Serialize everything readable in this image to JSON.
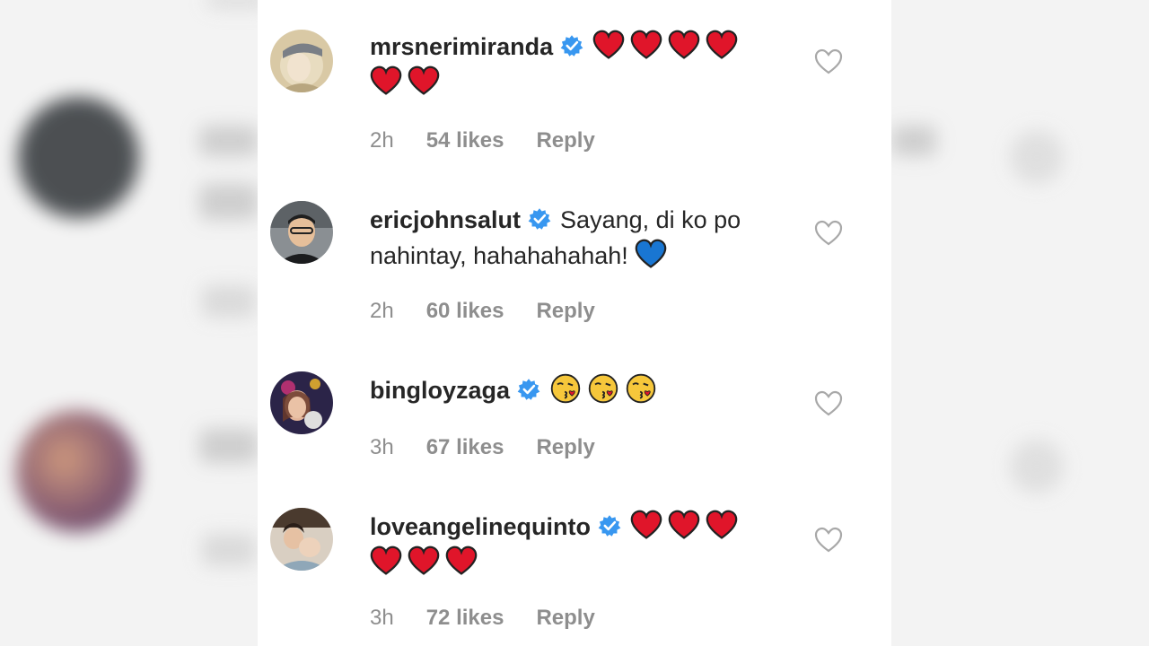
{
  "comments": [
    {
      "username": "mrsnerimiranda",
      "text": "",
      "emojis": [
        "red-heart",
        "red-heart",
        "red-heart",
        "red-heart",
        "red-heart",
        "red-heart"
      ],
      "time": "2h",
      "likes": "54 likes",
      "reply": "Reply"
    },
    {
      "username": "ericjohnsalut",
      "text": "Sayang, di ko po nahintay, hahahahahah!",
      "emojis": [
        "blue-heart"
      ],
      "time": "2h",
      "likes": "60 likes",
      "reply": "Reply"
    },
    {
      "username": "bingloyzaga",
      "text": "",
      "emojis": [
        "kissing-face",
        "kissing-face",
        "kissing-face"
      ],
      "time": "3h",
      "likes": "67 likes",
      "reply": "Reply"
    },
    {
      "username": "loveangelinequinto",
      "text": "",
      "emojis": [
        "red-heart",
        "red-heart",
        "red-heart",
        "red-heart",
        "red-heart",
        "red-heart"
      ],
      "time": "3h",
      "likes": "72 likes",
      "reply": "Reply"
    }
  ],
  "colors": {
    "verified": "#3897f0",
    "red_heart": "#e0152a",
    "blue_heart": "#1976d2",
    "meta_text": "#8e8e8e",
    "body_text": "#262626"
  }
}
